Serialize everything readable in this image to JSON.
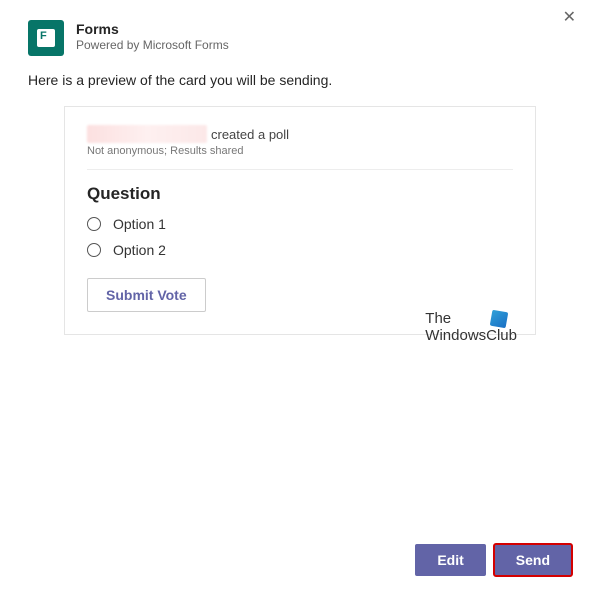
{
  "header": {
    "title": "Forms",
    "subtitle": "Powered by Microsoft Forms",
    "close": "✕"
  },
  "preview_text": "Here is a preview of the card you will be sending.",
  "card": {
    "creator_suffix": "created a poll",
    "meta": "Not anonymous; Results shared",
    "question": "Question",
    "options": [
      "Option 1",
      "Option 2"
    ],
    "submit": "Submit Vote"
  },
  "watermark": {
    "line1": "The",
    "line2": "WindowsClub"
  },
  "footer": {
    "edit": "Edit",
    "send": "Send"
  },
  "colors": {
    "accent": "#6264a7",
    "forms_green": "#077568",
    "highlight": "#d40000"
  }
}
